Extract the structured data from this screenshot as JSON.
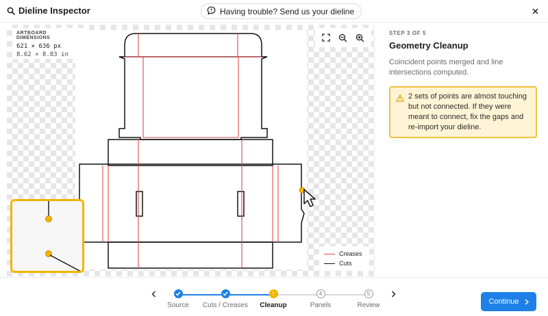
{
  "app": {
    "title": "Dieline Inspector",
    "help_text": "Having trouble? Send us your dieline"
  },
  "canvas": {
    "dims_label": "ARTBOARD DIMENSIONS",
    "dims_px": "621 × 636 px",
    "dims_in": "8.62 × 8.83 in",
    "legend": {
      "creases": "Creases",
      "cuts": "Cuts"
    }
  },
  "colors": {
    "crease": "#e04848",
    "cut": "#111111",
    "accent": "#1e80e6",
    "warning": "#f2b400"
  },
  "panel": {
    "step_label": "STEP 3 OF 5",
    "title": "Geometry Cleanup",
    "description": "Coincident points merged and line intersections computed.",
    "warning": "2 sets of points are almost touching but not connected. If they were meant to connect, fix the gaps and re-import your dieline."
  },
  "stepper": {
    "steps": [
      {
        "label": "Source",
        "status": "done"
      },
      {
        "label": "Cuts / Creases",
        "status": "done"
      },
      {
        "label": "Cleanup",
        "status": "active",
        "num": "!"
      },
      {
        "label": "Panels",
        "status": "pending",
        "num": "4"
      },
      {
        "label": "Review",
        "status": "pending",
        "num": "5"
      }
    ]
  },
  "footer": {
    "continue_label": "Continue"
  }
}
